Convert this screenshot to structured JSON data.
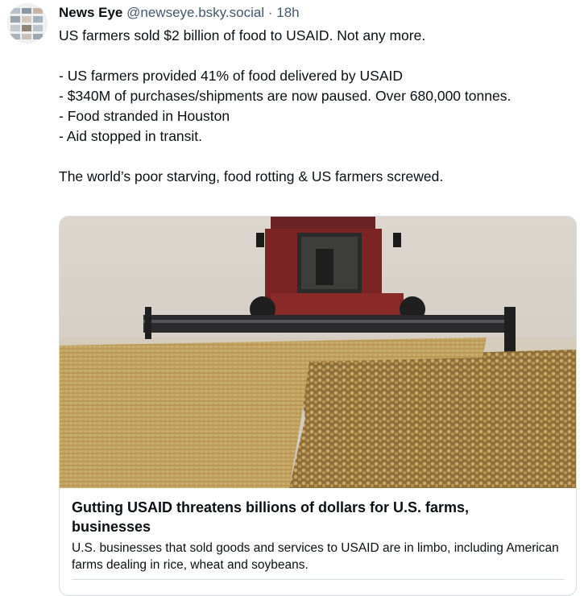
{
  "post": {
    "author": {
      "name": "News Eye",
      "handle": "@newseye.bsky.social",
      "separator": "·",
      "time": "18h"
    },
    "text": {
      "line1": "US farmers sold $2 billion of food to USAID. Not any more.",
      "bullet1": "- US farmers provided 41% of food delivered by USAID",
      "bullet2": "- $340M of purchases/shipments are now paused. Over 680,000 tonnes.",
      "bullet3": "- Food stranded in Houston",
      "bullet4": "- Aid stopped in transit.",
      "closing": "The world’s poor starving, food rotting & US farmers screwed."
    },
    "link_card": {
      "image_description": "combine harvester cutting wheat field",
      "title": "Gutting USAID threatens billions of dollars for U.S. farms, businesses",
      "description": "U.S. businesses that sold goods and services to USAID are in limbo, including American farms dealing in rice, wheat and soybeans."
    }
  }
}
